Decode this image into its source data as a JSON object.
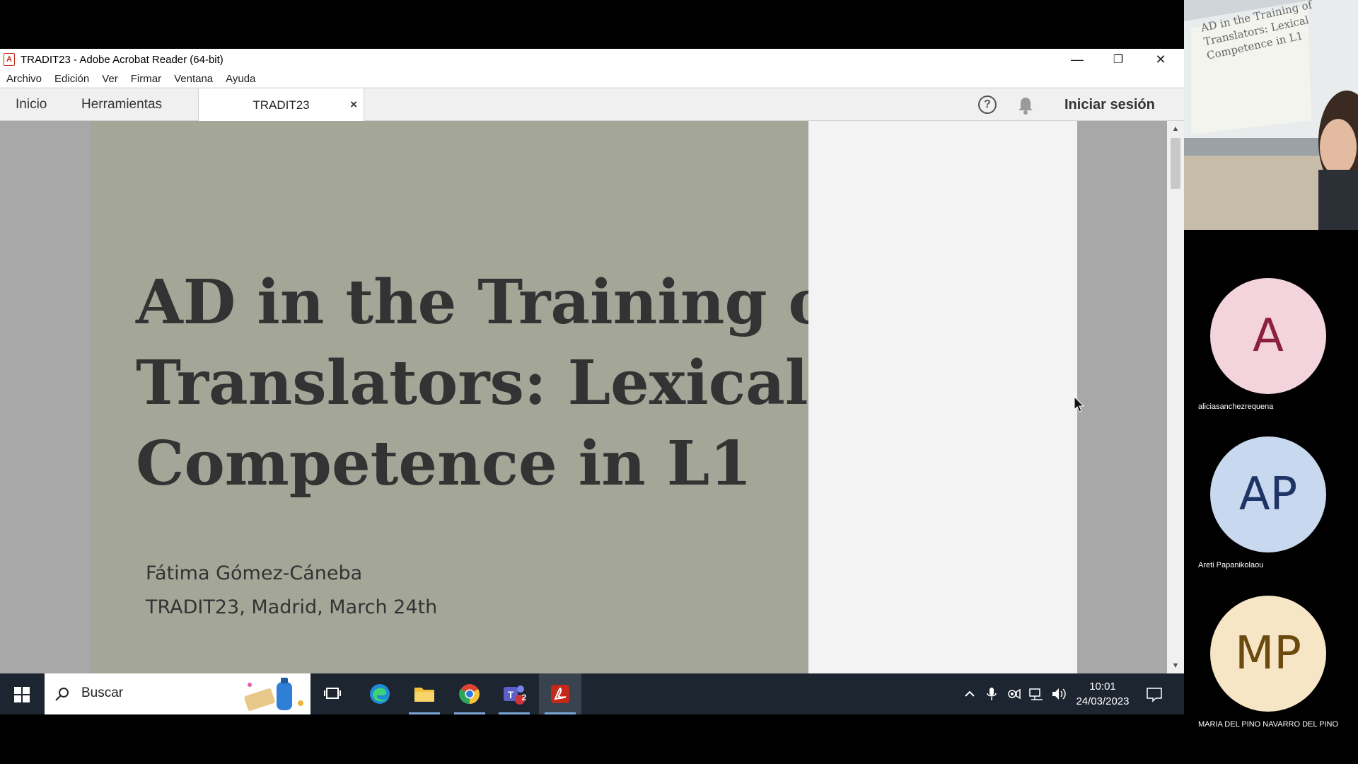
{
  "window": {
    "title": "TRADIT23 - Adobe Acrobat Reader (64-bit)",
    "controls": {
      "minimize": "—",
      "restore": "❐",
      "close": "✕"
    }
  },
  "menu": [
    "Archivo",
    "Edición",
    "Ver",
    "Firmar",
    "Ventana",
    "Ayuda"
  ],
  "tabs": {
    "home": "Inicio",
    "tools": "Herramientas",
    "document": "TRADIT23",
    "document_close": "×",
    "help_icon": "?",
    "signin": "Iniciar sesión"
  },
  "slide": {
    "title_lines": [
      "AD in the Training of",
      "Translators: Lexical",
      "Competence in L1"
    ],
    "author": "Fátima Gómez-Cáneba",
    "event": "TRADIT23, Madrid, March 24th"
  },
  "scrollbar": {
    "up": "▲",
    "down": "▼"
  },
  "taskbar": {
    "search_label": "Buscar",
    "teams_badge": "2",
    "clock_time": "10:01",
    "clock_date": "24/03/2023"
  },
  "participants": [
    {
      "initials": "A",
      "name": "aliciasanchezrequena",
      "bg": "#f4d4dc",
      "fg": "#8b2040"
    },
    {
      "initials": "AP",
      "name": "Areti Papanikolaou",
      "bg": "#c8d8ee",
      "fg": "#1f3466"
    },
    {
      "initials": "MP",
      "name": "MARIA DEL PINO NAVARRO DEL PINO",
      "bg": "#f7e6c6",
      "fg": "#6b4a10"
    }
  ],
  "video_slide_text": [
    "AD in the Training of",
    "Translators: Lexical",
    "Competence in L1"
  ],
  "colors": {
    "slide_bg": "#a4a698",
    "taskbar": "#1d2530",
    "acrobat_red": "#c4281b"
  }
}
